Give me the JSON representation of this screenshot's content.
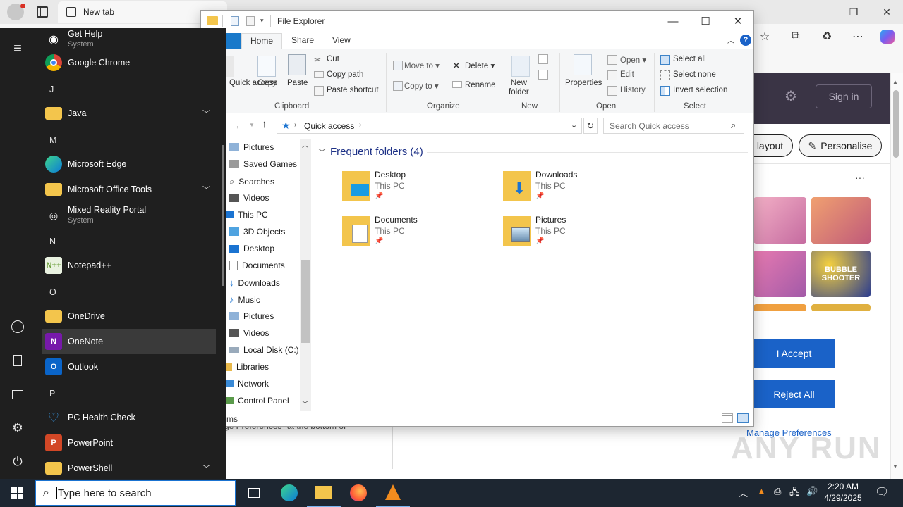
{
  "edge": {
    "tab_title": "New tab",
    "sign_in": "Sign in",
    "layout_label": "layout",
    "personalise_label": "Personalise",
    "accept_label": "I Accept",
    "reject_label": "Reject All",
    "manage_label": "Manage Preferences",
    "body_snippet": "ge Preferences\" at the bottom of",
    "more_dots": "···",
    "game_label": "BUBBLE SHOOTER"
  },
  "watermark": "ANY RUN",
  "explorer": {
    "title": "File Explorer",
    "tabs": [
      "Home",
      "Share",
      "View"
    ],
    "ribbon": {
      "quick_access": "Quick access",
      "copy": "Copy",
      "paste": "Paste",
      "cut": "Cut",
      "copy_path": "Copy path",
      "paste_shortcut": "Paste shortcut",
      "move_to": "Move to",
      "copy_to": "Copy to",
      "delete": "Delete",
      "rename": "Rename",
      "new_folder_1": "New",
      "new_folder_2": "folder",
      "properties": "Properties",
      "open": "Open",
      "edit": "Edit",
      "history": "History",
      "select_all": "Select all",
      "select_none": "Select none",
      "invert_selection": "Invert selection",
      "groups": [
        "Clipboard",
        "Organize",
        "New",
        "Open",
        "Select"
      ]
    },
    "address": "Quick access",
    "search_placeholder": "Search Quick access",
    "nav": [
      "Pictures",
      "Saved Games",
      "Searches",
      "Videos",
      "This PC",
      "3D Objects",
      "Desktop",
      "Documents",
      "Downloads",
      "Music",
      "Pictures",
      "Videos",
      "Local Disk (C:)",
      "Libraries",
      "Network",
      "Control Panel"
    ],
    "section_title": "Frequent folders (4)",
    "folders": [
      {
        "name": "Desktop",
        "location": "This PC"
      },
      {
        "name": "Downloads",
        "location": "This PC"
      },
      {
        "name": "Documents",
        "location": "This PC"
      },
      {
        "name": "Pictures",
        "location": "This PC"
      }
    ],
    "status": "ms"
  },
  "start_menu": {
    "apps": {
      "get_help": {
        "name": "Get Help",
        "sub": "System"
      },
      "chrome": {
        "name": "Google Chrome"
      },
      "java": {
        "name": "Java"
      },
      "edge": {
        "name": "Microsoft Edge"
      },
      "office_tools": {
        "name": "Microsoft Office Tools"
      },
      "mixed_reality": {
        "name": "Mixed Reality Portal",
        "sub": "System"
      },
      "notepadpp": {
        "name": "Notepad++"
      },
      "onedrive": {
        "name": "OneDrive"
      },
      "onenote": {
        "name": "OneNote"
      },
      "outlook": {
        "name": "Outlook"
      },
      "pc_health": {
        "name": "PC Health Check"
      },
      "powerpoint": {
        "name": "PowerPoint"
      },
      "powershell": {
        "name": "PowerShell"
      }
    },
    "letters": {
      "j": "J",
      "m": "M",
      "n": "N",
      "o": "O",
      "p": "P"
    }
  },
  "taskbar": {
    "search_placeholder": "Type here to search",
    "time": "2:20 AM",
    "date": "4/29/2025"
  },
  "colors": {
    "accent": "#1979ca",
    "start_bg": "#1f1f1f",
    "taskbar_bg": "#1d2631",
    "edge_button": "#1a62c8"
  }
}
